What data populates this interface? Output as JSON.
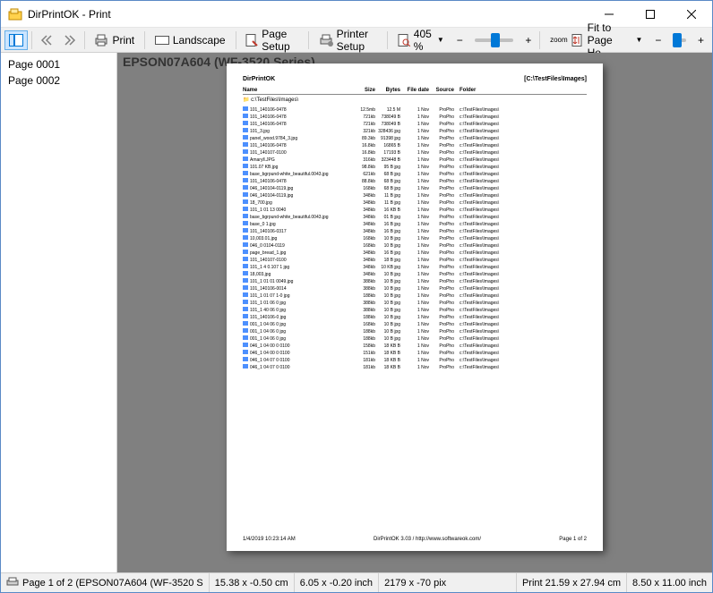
{
  "window": {
    "title": "DirPrintOK - Print"
  },
  "toolbar": {
    "print": "Print",
    "landscape": "Landscape",
    "page_setup": "Page Setup",
    "printer_setup": "Printer Setup",
    "zoom_value": "405 %",
    "fit_label": "Fit to Page He...",
    "zoom_prefix": "zoom"
  },
  "sidebar": {
    "items": [
      {
        "label": "Page 0001"
      },
      {
        "label": "Page 0002"
      }
    ]
  },
  "preview": {
    "printer_name": "EPSON07A604 (WF-3520 Series)",
    "page": {
      "doc_title": "DirPrintOK",
      "path_label": "[C:\\TestFiles\\Images]",
      "subpath": "c:\\TestFiles\\Images\\",
      "columns": {
        "name": "Name",
        "size": "Size",
        "bytes": "Bytes",
        "filedate": "File date",
        "source": "Source",
        "folder": "Folder"
      },
      "rows": [
        {
          "n": "101_140106-0478",
          "s": "12.5mb",
          "b": "12.5 M",
          "d": "1 Nov",
          "sc": "ProPho",
          "f": "c:\\TestFiles\\Images\\"
        },
        {
          "n": "101_140106-0478",
          "s": "721kb",
          "b": "738049 B",
          "d": "1 Nov",
          "sc": "ProPho",
          "f": "c:\\TestFiles\\Images\\"
        },
        {
          "n": "101_140106-0478",
          "s": "721kb",
          "b": "738049 B",
          "d": "1 Nov",
          "sc": "ProPho",
          "f": "c:\\TestFiles\\Images\\"
        },
        {
          "n": "101_3.jpg",
          "s": "321kb",
          "b": "328436 jpg",
          "d": "1 Nov",
          "sc": "ProPho",
          "f": "c:\\TestFiles\\Images\\"
        },
        {
          "n": "panel_wood.9784_3.jpg",
          "s": "89.3kb",
          "b": "91398 jpg",
          "d": "1 Nov",
          "sc": "ProPho",
          "f": "c:\\TestFiles\\Images\\"
        },
        {
          "n": "101_140106-0478",
          "s": "16.8kb",
          "b": "16865 B",
          "d": "1 Nov",
          "sc": "ProPho",
          "f": "c:\\TestFiles\\Images\\"
        },
        {
          "n": "101_140107-0100",
          "s": "16.8kb",
          "b": "17193 B",
          "d": "1 Nov",
          "sc": "ProPho",
          "f": "c:\\TestFiles\\Images\\"
        },
        {
          "n": "Amaryll.JPG",
          "s": "316kb",
          "b": "323448 B",
          "d": "1 Nov",
          "sc": "ProPho",
          "f": "c:\\TestFiles\\Images\\"
        },
        {
          "n": "101.07 KB.jpg",
          "s": "98.8kb",
          "b": "95 B jpg",
          "d": "1 Nov",
          "sc": "ProPho",
          "f": "c:\\TestFiles\\Images\\"
        },
        {
          "n": "base_bgrpund-white_beautiful.0043.jpg",
          "s": "621kb",
          "b": "68 B jpg",
          "d": "1 Nov",
          "sc": "ProPho",
          "f": "c:\\TestFiles\\Images\\"
        },
        {
          "n": "101_140106-0478",
          "s": "88.8kb",
          "b": "68 B jpg",
          "d": "1 Nov",
          "sc": "ProPho",
          "f": "c:\\TestFiles\\Images\\"
        },
        {
          "n": "046_140104-0119.jpg",
          "s": "168kb",
          "b": "68 B jpg",
          "d": "1 Nov",
          "sc": "ProPho",
          "f": "c:\\TestFiles\\Images\\"
        },
        {
          "n": "046_140104-0119.jpg",
          "s": "348kb",
          "b": "11 B jpg",
          "d": "1 Nov",
          "sc": "ProPho",
          "f": "c:\\TestFiles\\Images\\"
        },
        {
          "n": "18_700.jpg",
          "s": "348kb",
          "b": "11 B jpg",
          "d": "1 Nov",
          "sc": "ProPho",
          "f": "c:\\TestFiles\\Images\\"
        },
        {
          "n": "101_1 01 13 0040",
          "s": "348kb",
          "b": "16 KB B",
          "d": "1 Nov",
          "sc": "ProPho",
          "f": "c:\\TestFiles\\Images\\"
        },
        {
          "n": "base_bgrpund-white_beautiful.0043.jpg",
          "s": "348kb",
          "b": "01 B jpg",
          "d": "1 Nov",
          "sc": "ProPho",
          "f": "c:\\TestFiles\\Images\\"
        },
        {
          "n": "base_0 1.jpg",
          "s": "348kb",
          "b": "16 B jpg",
          "d": "1 Nov",
          "sc": "ProPho",
          "f": "c:\\TestFiles\\Images\\"
        },
        {
          "n": "101_140106-0317",
          "s": "348kb",
          "b": "16 B jpg",
          "d": "1 Nov",
          "sc": "ProPho",
          "f": "c:\\TestFiles\\Images\\"
        },
        {
          "n": "10,003.01.jpg",
          "s": "168kb",
          "b": "10 B jpg",
          "d": "1 Nov",
          "sc": "ProPho",
          "f": "c:\\TestFiles\\Images\\"
        },
        {
          "n": "046_0 0104-0119",
          "s": "168kb",
          "b": "10 B jpg",
          "d": "1 Nov",
          "sc": "ProPho",
          "f": "c:\\TestFiles\\Images\\"
        },
        {
          "n": "page_bread_1.jpg",
          "s": "348kb",
          "b": "16 B jpg",
          "d": "1 Nov",
          "sc": "ProPho",
          "f": "c:\\TestFiles\\Images\\"
        },
        {
          "n": "101_140107-0100",
          "s": "348kb",
          "b": "18 B jpg",
          "d": "1 Nov",
          "sc": "ProPho",
          "f": "c:\\TestFiles\\Images\\"
        },
        {
          "n": "101_1 4 0.107 1 jpg",
          "s": "348kb",
          "b": "10 KB jpg",
          "d": "1 Nov",
          "sc": "ProPho",
          "f": "c:\\TestFiles\\Images\\"
        },
        {
          "n": "18,003.jpg",
          "s": "348kb",
          "b": "10 B jpg",
          "d": "1 Nov",
          "sc": "ProPho",
          "f": "c:\\TestFiles\\Images\\"
        },
        {
          "n": "101_1 01 01 0049.jpg",
          "s": "388kb",
          "b": "10 B jpg",
          "d": "1 Nov",
          "sc": "ProPho",
          "f": "c:\\TestFiles\\Images\\"
        },
        {
          "n": "101_140106-0014",
          "s": "388kb",
          "b": "10 B jpg",
          "d": "1 Nov",
          "sc": "ProPho",
          "f": "c:\\TestFiles\\Images\\"
        },
        {
          "n": "101_1 01 07 1-0 jpg",
          "s": "188kb",
          "b": "10 B jpg",
          "d": "1 Nov",
          "sc": "ProPho",
          "f": "c:\\TestFiles\\Images\\"
        },
        {
          "n": "101_1 01 06 0 jpg",
          "s": "388kb",
          "b": "10 B jpg",
          "d": "1 Nov",
          "sc": "ProPho",
          "f": "c:\\TestFiles\\Images\\"
        },
        {
          "n": "101_1 40 06 0 jpg",
          "s": "388kb",
          "b": "10 B jpg",
          "d": "1 Nov",
          "sc": "ProPho",
          "f": "c:\\TestFiles\\Images\\"
        },
        {
          "n": "101_140106-0 jpg",
          "s": "188kb",
          "b": "10 B jpg",
          "d": "1 Nov",
          "sc": "ProPho",
          "f": "c:\\TestFiles\\Images\\"
        },
        {
          "n": "001_1 04 06 0 jpg",
          "s": "168kb",
          "b": "10 B jpg",
          "d": "1 Nov",
          "sc": "ProPho",
          "f": "c:\\TestFiles\\Images\\"
        },
        {
          "n": "001_1 04 06 0 jpg",
          "s": "188kb",
          "b": "10 B jpg",
          "d": "1 Nov",
          "sc": "ProPho",
          "f": "c:\\TestFiles\\Images\\"
        },
        {
          "n": "001_1 04 06 0 jpg",
          "s": "188kb",
          "b": "10 B jpg",
          "d": "1 Nov",
          "sc": "ProPho",
          "f": "c:\\TestFiles\\Images\\"
        },
        {
          "n": "046_1 04 00 0 0100",
          "s": "158kb",
          "b": "18 KB B",
          "d": "1 Nov",
          "sc": "ProPho",
          "f": "c:\\TestFiles\\Images\\"
        },
        {
          "n": "046_1 04 00 0 0100",
          "s": "151kb",
          "b": "18 KB B",
          "d": "1 Nov",
          "sc": "ProPho",
          "f": "c:\\TestFiles\\Images\\"
        },
        {
          "n": "046_1 04 07 0 0100",
          "s": "181kb",
          "b": "18 KB B",
          "d": "1 Nov",
          "sc": "ProPho",
          "f": "c:\\TestFiles\\Images\\"
        },
        {
          "n": "046_1 04 07 0 0100",
          "s": "181kb",
          "b": "18 KB B",
          "d": "1 Nov",
          "sc": "ProPho",
          "f": "c:\\TestFiles\\Images\\"
        }
      ],
      "footer": {
        "date": "1/4/2019 10:23:14 AM",
        "software": "DirPrintOK 3.03 / http://www.softwareok.com/",
        "pagenum": "Page 1 of 2"
      }
    }
  },
  "statusbar": {
    "page_info": "Page 1 of 2 (EPSON07A604 (WF-3520 S",
    "pos_cm": "15.38 x -0.50 cm",
    "pos_inch": "6.05 x -0.20 inch",
    "pos_pix": "2179 x -70 pix",
    "print_cm": "Print 21.59 x 27.94 cm",
    "print_inch": "8.50 x 11.00 inch"
  }
}
